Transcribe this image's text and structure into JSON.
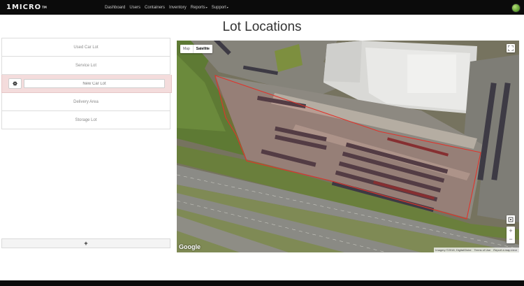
{
  "navbar": {
    "brand": "1MICRO",
    "brand_tm": "TM",
    "items": [
      {
        "label": "Dashboard"
      },
      {
        "label": "Users"
      },
      {
        "label": "Containers"
      },
      {
        "label": "Inventory"
      },
      {
        "label": "Reports",
        "caret": "▾"
      },
      {
        "label": "Support",
        "caret": "▾"
      }
    ]
  },
  "page": {
    "title": "Lot Locations"
  },
  "lots": {
    "items": [
      {
        "label": "Used Car Lot"
      },
      {
        "label": "Service Lot"
      },
      {
        "label": "New Car Lot",
        "editing": true
      },
      {
        "label": "Delivery Area"
      },
      {
        "label": "Storage Lot"
      }
    ],
    "add_label": "+"
  },
  "map": {
    "type_options": [
      "Map",
      "Satellite"
    ],
    "selected_type": "Satellite",
    "google_logo": "Google",
    "attribution": [
      "Imagery ©2018, DigitalGlobe",
      "Terms of Use",
      "Report a map error"
    ],
    "zoom_in": "+",
    "zoom_out": "−",
    "polygon_color": "#e0332b"
  },
  "colors": {
    "navbar_bg": "#0b0b0b",
    "active_row_bg": "#f4dcdc"
  }
}
